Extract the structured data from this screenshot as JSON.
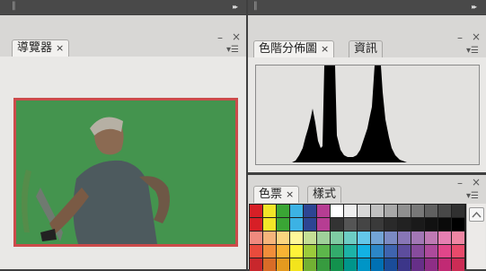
{
  "navigator": {
    "tab_label": "導覽器",
    "close_glyph": "×"
  },
  "histogram": {
    "tab_label": "色階分佈圖",
    "close_glyph": "×"
  },
  "info": {
    "tab_label": "資訊"
  },
  "swatches": {
    "tab_label": "色票",
    "close_glyph": "×"
  },
  "styles": {
    "tab_label": "樣式"
  },
  "controls": {
    "minimize": "–",
    "close": "×",
    "menu": "▾☰",
    "expand": "▸▸",
    "grip": "||"
  },
  "palette": {
    "row1": [
      "#d71f26",
      "#f2e528",
      "#3aa535",
      "#3cb2e4",
      "#2d4593",
      "#b63d93",
      "#ffffff",
      "#eeeeee",
      "#d8d8d8",
      "#c0c0c0",
      "#a8a8a8",
      "#909090",
      "#787878",
      "#606060",
      "#484848",
      "#303030"
    ],
    "row2": [
      "#d71f26",
      "#f2e528",
      "#3aa535",
      "#3cb2e4",
      "#2d4593",
      "#b63d93",
      "#333333",
      "#555555",
      "#454545",
      "#3a3a3a",
      "#2a2a2a",
      "#222222",
      "#1a1a1a",
      "#111111",
      "#0a0a0a",
      "#000000"
    ],
    "row3": [
      "#f08a7e",
      "#f6b57b",
      "#fbd57f",
      "#fff799",
      "#c5df95",
      "#9fd09a",
      "#7fcba3",
      "#6dcdc4",
      "#64c7e9",
      "#73a4d6",
      "#7b8ac3",
      "#8876b6",
      "#a277b5",
      "#bf7ab4",
      "#e57fb2",
      "#ef86a3"
    ],
    "row4": [
      "#e94b3c",
      "#f18d3a",
      "#f8b334",
      "#fff33a",
      "#9ccb3b",
      "#5db74b",
      "#33ab6c",
      "#1db2a7",
      "#13b1e3",
      "#2c86c7",
      "#3f64af",
      "#5d4d9d",
      "#874c9d",
      "#ad4a9b",
      "#e1468a",
      "#e84a6b"
    ],
    "row5": [
      "#c8272c",
      "#d86c27",
      "#e49a1f",
      "#f3e41c",
      "#72b033",
      "#379b3f",
      "#13914d",
      "#00958a",
      "#0095c6",
      "#0070b3",
      "#1a4c99",
      "#3c3689",
      "#662f88",
      "#8e2e86",
      "#c12a74",
      "#cb2c55"
    ]
  }
}
